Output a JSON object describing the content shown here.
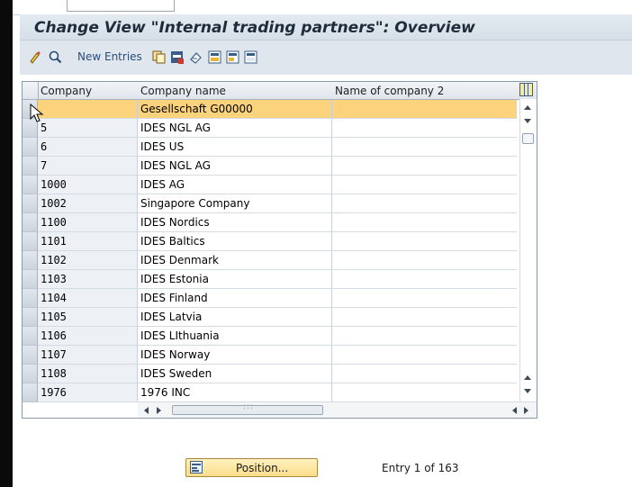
{
  "window": {
    "title": "Change View \"Internal trading partners\": Overview"
  },
  "toolbar": {
    "new_entries_label": "New Entries",
    "icons": [
      "display-change-icon",
      "find-icon",
      "copy-as-icon",
      "delete-icon",
      "undo-change-icon",
      "select-all-icon",
      "select-block-icon",
      "deselect-all-icon"
    ]
  },
  "table": {
    "columns": [
      "Company",
      "Company name",
      "Name of company 2"
    ],
    "rows": [
      {
        "company": "",
        "name": "Gesellschaft G00000",
        "name2": "",
        "selected": true
      },
      {
        "company": "5",
        "name": "IDES NGL AG",
        "name2": ""
      },
      {
        "company": "6",
        "name": "IDES US",
        "name2": ""
      },
      {
        "company": "7",
        "name": "IDES NGL AG",
        "name2": ""
      },
      {
        "company": "1000",
        "name": "IDES AG",
        "name2": ""
      },
      {
        "company": "1002",
        "name": "Singapore Company",
        "name2": ""
      },
      {
        "company": "1100",
        "name": "IDES Nordics",
        "name2": ""
      },
      {
        "company": "1101",
        "name": "IDES Baltics",
        "name2": ""
      },
      {
        "company": "1102",
        "name": "IDES Denmark",
        "name2": ""
      },
      {
        "company": "1103",
        "name": "IDES Estonia",
        "name2": ""
      },
      {
        "company": "1104",
        "name": "IDES Finland",
        "name2": ""
      },
      {
        "company": "1105",
        "name": "IDES Latvia",
        "name2": ""
      },
      {
        "company": "1106",
        "name": "IDES LIthuania",
        "name2": ""
      },
      {
        "company": "1107",
        "name": "IDES Norway",
        "name2": ""
      },
      {
        "company": "1108",
        "name": "IDES Sweden",
        "name2": ""
      },
      {
        "company": "1976",
        "name": "1976 INC",
        "name2": ""
      }
    ],
    "hscroll_grip": ":::"
  },
  "footer": {
    "position_label": "Position...",
    "entry_text": "Entry 1 of 163"
  },
  "colors": {
    "selected_row": "#fbd37c",
    "title_text": "#1f2b3a",
    "header_bg": "#dfe6ee",
    "button_bg": "#fbdd8a"
  }
}
